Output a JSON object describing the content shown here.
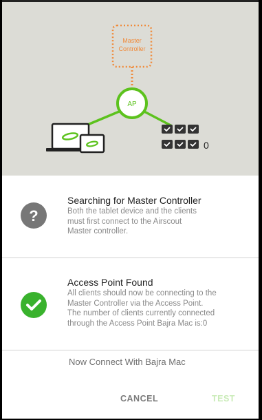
{
  "diagram": {
    "master_label_line1": "Master",
    "master_label_line2": "Controller",
    "ap_label": "AP",
    "client_count": "0",
    "colors": {
      "master": "#f08a3a",
      "ap": "#5cc21d",
      "background": "#dcdcd6"
    }
  },
  "searching": {
    "title": "Searching for Master Controller",
    "description_lines": [
      "Both the tablet device and the clients",
      "must first connect to the Airscout",
      "Master controller."
    ],
    "icon": "question-circle-icon"
  },
  "ap_found": {
    "title": "Access Point Found",
    "description_lines": [
      "All clients should now be connecting to the",
      "Master Controller via the Access Point.",
      "The number of clients currently connected",
      "through the Access Point Bajra Mac is:0"
    ],
    "icon": "check-circle-icon"
  },
  "connect_text": "Now Connect With Bajra Mac",
  "buttons": {
    "cancel": "CANCEL",
    "test": "TEST"
  }
}
